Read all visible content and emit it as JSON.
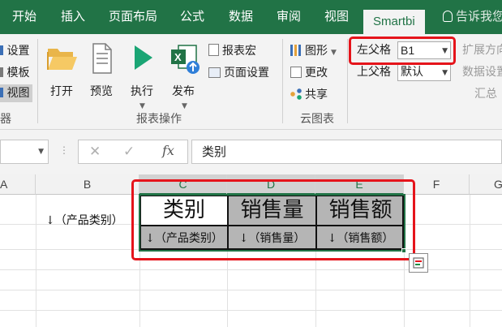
{
  "tabs": [
    {
      "label": "开始"
    },
    {
      "label": "插入"
    },
    {
      "label": "页面布局"
    },
    {
      "label": "公式"
    },
    {
      "label": "数据"
    },
    {
      "label": "审阅"
    },
    {
      "label": "视图"
    },
    {
      "label": "Smartbi"
    }
  ],
  "tell_me": "告诉我您",
  "ribbon": {
    "left": {
      "settings": "设置",
      "template": "模板",
      "view": "视图",
      "group_tail": "器"
    },
    "buttons": {
      "open": "打开",
      "preview": "预览",
      "execute": "执行",
      "publish": "发布"
    },
    "report_macro": "报表宏",
    "page_setup": "页面设置",
    "group_report_ops": "报表操作",
    "cloud": {
      "chart": "图形",
      "change": "更改",
      "share": "共享",
      "group_label": "云图表"
    },
    "left_parent_label": "左父格",
    "left_parent_value": "B1",
    "top_parent_label": "上父格",
    "top_parent_value": "默认",
    "expand_direction": "扩展方向",
    "data_settings": "数据设置",
    "summary": "汇总"
  },
  "formula_bar": {
    "fx": "fx",
    "content": "类别"
  },
  "sheet": {
    "columns": [
      "A",
      "B",
      "C",
      "D",
      "E",
      "F",
      "G"
    ],
    "selected_columns": [
      "C",
      "D",
      "E"
    ],
    "b_cell": "↓（产品类别）",
    "headers": [
      "类别",
      "销售量",
      "销售额"
    ],
    "fields": [
      "↓（产品类别）",
      "↓（销售量）",
      "↓（销售额）"
    ]
  },
  "colors": {
    "excel_green": "#217346",
    "highlight_red": "#e5141b",
    "selection_fill": "#b5b5b5",
    "arrow_green": "#1f8d42"
  }
}
